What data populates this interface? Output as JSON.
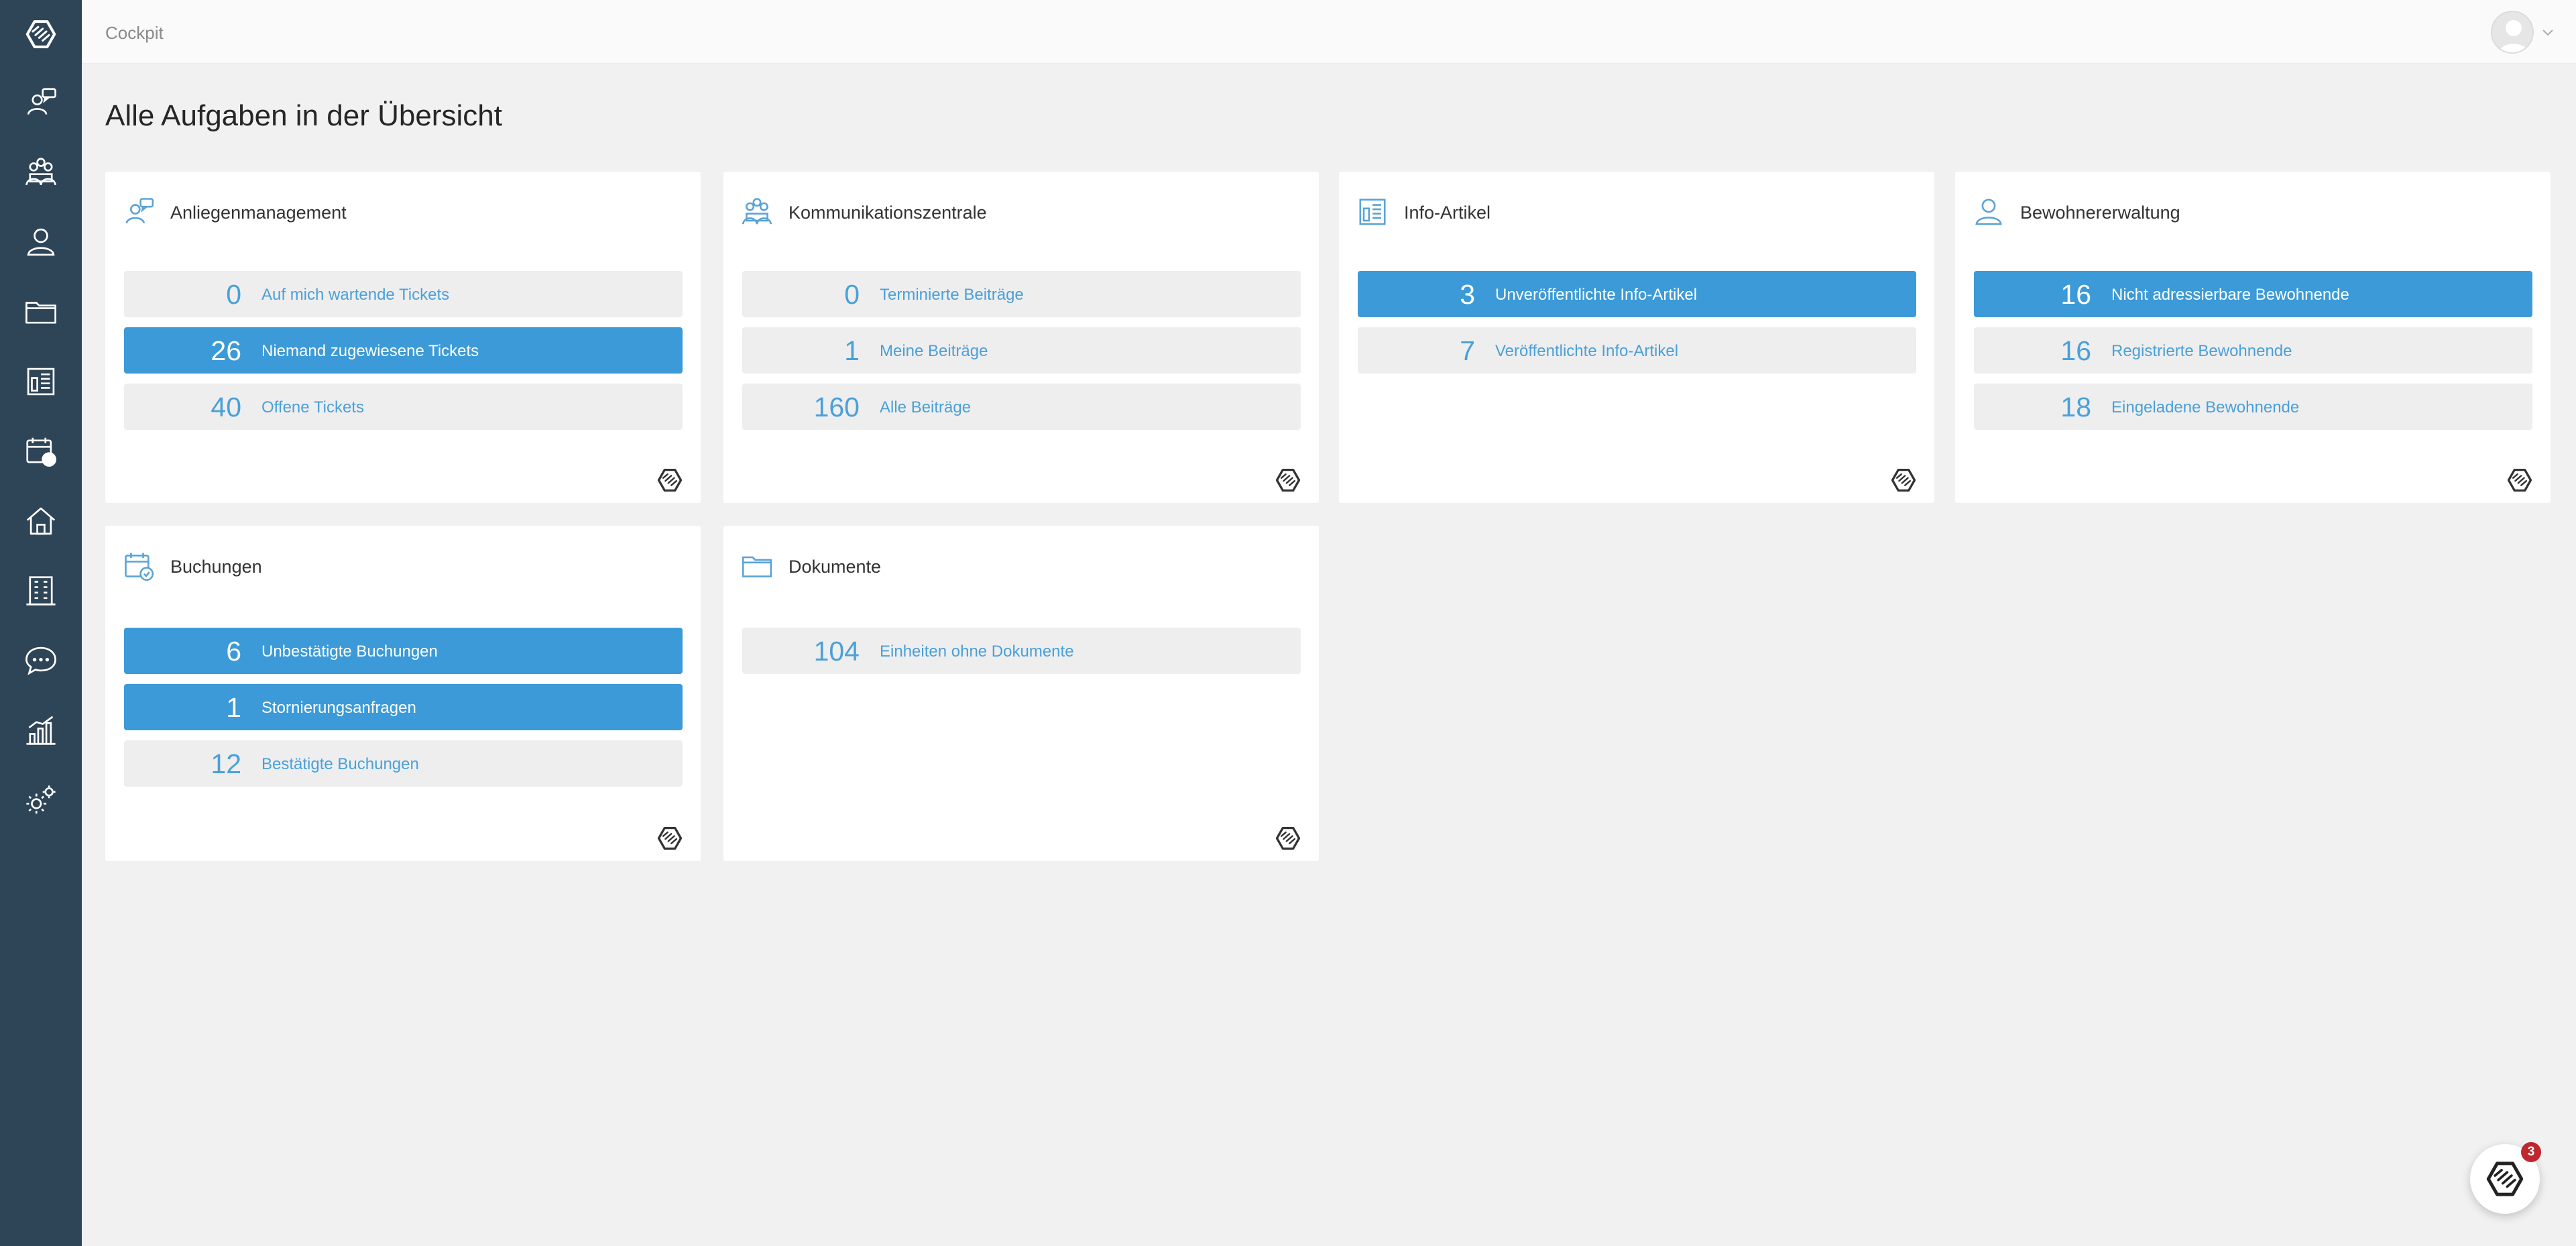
{
  "header": {
    "breadcrumb": "Cockpit"
  },
  "page": {
    "title": "Alle Aufgaben in der Übersicht"
  },
  "colors": {
    "sidebar": "#2e4457",
    "accent": "#3b9ad7",
    "badge": "#c0262d"
  },
  "sidebar": {
    "items": [
      {
        "icon": "logo-icon"
      },
      {
        "icon": "anliegen-icon"
      },
      {
        "icon": "kommunikation-icon"
      },
      {
        "icon": "person-icon"
      },
      {
        "icon": "folder-icon"
      },
      {
        "icon": "info-article-icon"
      },
      {
        "icon": "calendar-check-icon"
      },
      {
        "icon": "home-icon"
      },
      {
        "icon": "building-icon"
      },
      {
        "icon": "chat-bubble-icon"
      },
      {
        "icon": "statistics-icon"
      },
      {
        "icon": "settings-icon"
      }
    ]
  },
  "cards": [
    {
      "title": "Anliegenmanagement",
      "icon": "anliegen-icon",
      "rows": [
        {
          "count": "0",
          "label": "Auf mich wartende Tickets",
          "active": false
        },
        {
          "count": "26",
          "label": "Niemand zugewiesene Tickets",
          "active": true
        },
        {
          "count": "40",
          "label": "Offene Tickets",
          "active": false
        }
      ]
    },
    {
      "title": "Kommunikationszentrale",
      "icon": "kommunikation-icon",
      "rows": [
        {
          "count": "0",
          "label": "Terminierte Beiträge",
          "active": false
        },
        {
          "count": "1",
          "label": "Meine Beiträge",
          "active": false
        },
        {
          "count": "160",
          "label": "Alle Beiträge",
          "active": false
        }
      ]
    },
    {
      "title": "Info-Artikel",
      "icon": "info-article-icon",
      "rows": [
        {
          "count": "3",
          "label": "Unveröffentlichte Info-Artikel",
          "active": true
        },
        {
          "count": "7",
          "label": "Veröffentlichte Info-Artikel",
          "active": false
        }
      ]
    },
    {
      "title": "Bewohnererwaltung",
      "icon": "person-icon",
      "rows": [
        {
          "count": "16",
          "label": "Nicht adressierbare Bewohnende",
          "active": true
        },
        {
          "count": "16",
          "label": "Registrierte Bewohnende",
          "active": false
        },
        {
          "count": "18",
          "label": "Eingeladene Bewohnende",
          "active": false
        }
      ]
    },
    {
      "title": "Buchungen",
      "icon": "calendar-check-icon",
      "rows": [
        {
          "count": "6",
          "label": "Unbestätigte Buchungen",
          "active": true
        },
        {
          "count": "1",
          "label": "Stornierungsanfragen",
          "active": true
        },
        {
          "count": "12",
          "label": "Bestätigte Buchungen",
          "active": false
        }
      ]
    },
    {
      "title": "Dokumente",
      "icon": "folder-icon",
      "rows": [
        {
          "count": "104",
          "label": "Einheiten ohne Dokumente",
          "active": false
        }
      ]
    }
  ],
  "chat": {
    "badge_count": "3",
    "icon": "chat-logo-icon"
  }
}
